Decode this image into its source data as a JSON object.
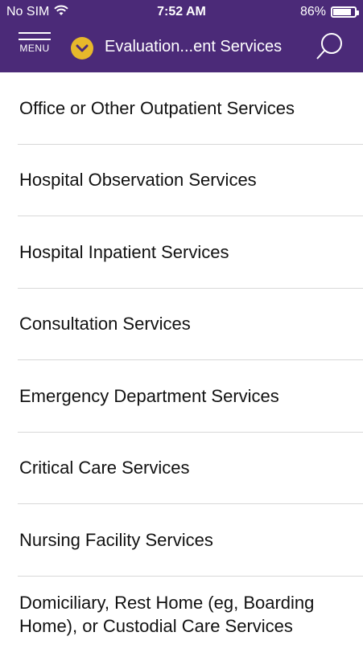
{
  "status_bar": {
    "carrier": "No SIM",
    "time": "7:52 AM",
    "battery_text": "86%",
    "battery_level": 0.86,
    "icons": [
      "wifi-icon",
      "battery-icon"
    ]
  },
  "header": {
    "menu_label": "MENU",
    "title": "Evaluation...ent Services",
    "badge_color": "#e7b82b",
    "bar_color": "#4b2a78",
    "icons": [
      "hamburger-icon",
      "chevron-down-icon",
      "search-icon"
    ]
  },
  "list": {
    "items": [
      {
        "label": "Office or Other Outpatient Services"
      },
      {
        "label": "Hospital Observation Services"
      },
      {
        "label": "Hospital Inpatient Services"
      },
      {
        "label": "Consultation Services"
      },
      {
        "label": "Emergency Department Services"
      },
      {
        "label": "Critical Care Services"
      },
      {
        "label": "Nursing Facility Services"
      },
      {
        "label": "Domiciliary, Rest Home (eg, Boarding Home), or Custodial Care Services"
      }
    ]
  }
}
